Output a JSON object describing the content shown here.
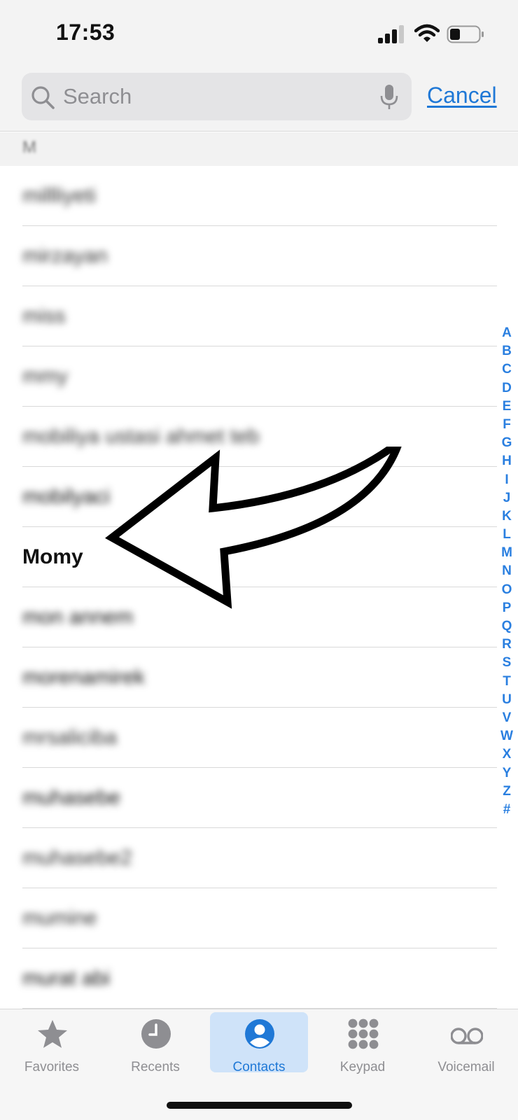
{
  "status": {
    "time": "17:53"
  },
  "search": {
    "placeholder": "Search",
    "cancel_label": "Cancel"
  },
  "section": {
    "letter": "M"
  },
  "contacts": [
    {
      "name": "millliyeti",
      "blurred": true
    },
    {
      "name": "mirzayan",
      "blurred": true
    },
    {
      "name": "miss",
      "blurred": true
    },
    {
      "name": "mmy",
      "blurred": true
    },
    {
      "name": "mobiliya ustasi ahmet teb",
      "blurred": true
    },
    {
      "name": "mobilyaci",
      "blurred": true
    },
    {
      "name": "Momy",
      "blurred": false
    },
    {
      "name": "mon annem",
      "blurred": true
    },
    {
      "name": "morenamirek",
      "blurred": true
    },
    {
      "name": "mrsaliciba",
      "blurred": true
    },
    {
      "name": "muhasebe",
      "blurred": true
    },
    {
      "name": "muhasebe2",
      "blurred": true
    },
    {
      "name": "mumine",
      "blurred": true
    },
    {
      "name": "murat abi",
      "blurred": true
    }
  ],
  "index_letters": [
    "A",
    "B",
    "C",
    "D",
    "E",
    "F",
    "G",
    "H",
    "I",
    "J",
    "K",
    "L",
    "M",
    "N",
    "O",
    "P",
    "Q",
    "R",
    "S",
    "T",
    "U",
    "V",
    "W",
    "X",
    "Y",
    "Z",
    "#"
  ],
  "tabs": [
    {
      "label": "Favorites",
      "icon": "star-icon",
      "active": false
    },
    {
      "label": "Recents",
      "icon": "clock-icon",
      "active": false
    },
    {
      "label": "Contacts",
      "icon": "person-circle-icon",
      "active": true
    },
    {
      "label": "Keypad",
      "icon": "keypad-icon",
      "active": false
    },
    {
      "label": "Voicemail",
      "icon": "voicemail-icon",
      "active": false
    }
  ],
  "colors": {
    "accent": "#1f78d6",
    "tab_inactive": "#8e8e92",
    "active_tab_bg": "#cfe3f9"
  }
}
